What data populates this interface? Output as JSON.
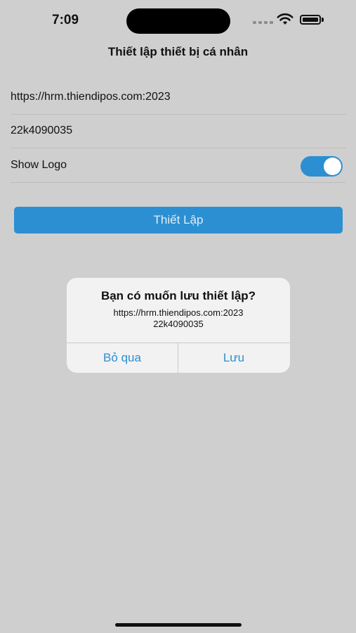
{
  "status_bar": {
    "time": "7:09"
  },
  "page": {
    "title": "Thiết lập thiết bị cá nhân"
  },
  "form": {
    "server_url": "https://hrm.thiendipos.com:2023",
    "device_id": "22k4090035",
    "show_logo_label": "Show Logo",
    "show_logo_enabled": true
  },
  "setup_button": {
    "label": "Thiết Lập"
  },
  "alert": {
    "title": "Bạn có muốn lưu thiết lập?",
    "message_line1": "https://hrm.thiendipos.com:2023",
    "message_line2": "22k4090035",
    "cancel_label": "Bỏ qua",
    "save_label": "Lưu"
  },
  "colors": {
    "accent": "#2b8fd2",
    "background": "#cfcfcf"
  }
}
